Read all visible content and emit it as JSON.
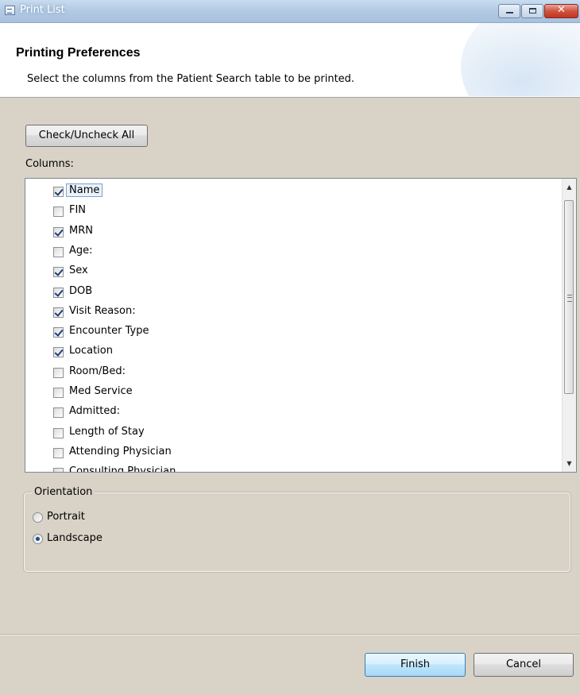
{
  "window": {
    "title": "Print List"
  },
  "header": {
    "title": "Printing Preferences",
    "description": "Select the columns from the Patient Search table to be printed."
  },
  "check_all_button": "Check/Uncheck All",
  "columns_label": "Columns:",
  "columns": [
    {
      "label": "Name",
      "checked": true
    },
    {
      "label": "FIN",
      "checked": false
    },
    {
      "label": "MRN",
      "checked": true
    },
    {
      "label": "Age:",
      "checked": false
    },
    {
      "label": "Sex",
      "checked": true
    },
    {
      "label": "DOB",
      "checked": true
    },
    {
      "label": "Visit Reason:",
      "checked": true
    },
    {
      "label": "Encounter Type",
      "checked": true
    },
    {
      "label": "Location",
      "checked": true
    },
    {
      "label": "Room/Bed:",
      "checked": false
    },
    {
      "label": "Med Service",
      "checked": false
    },
    {
      "label": "Admitted:",
      "checked": false
    },
    {
      "label": "Length of Stay",
      "checked": false
    },
    {
      "label": "Attending Physician",
      "checked": false
    },
    {
      "label": "Consulting Physician",
      "checked": false
    }
  ],
  "orientation": {
    "legend": "Orientation",
    "options": [
      {
        "label": "Portrait",
        "selected": false
      },
      {
        "label": "Landscape",
        "selected": true
      }
    ]
  },
  "buttons": {
    "finish": "Finish",
    "cancel": "Cancel"
  }
}
